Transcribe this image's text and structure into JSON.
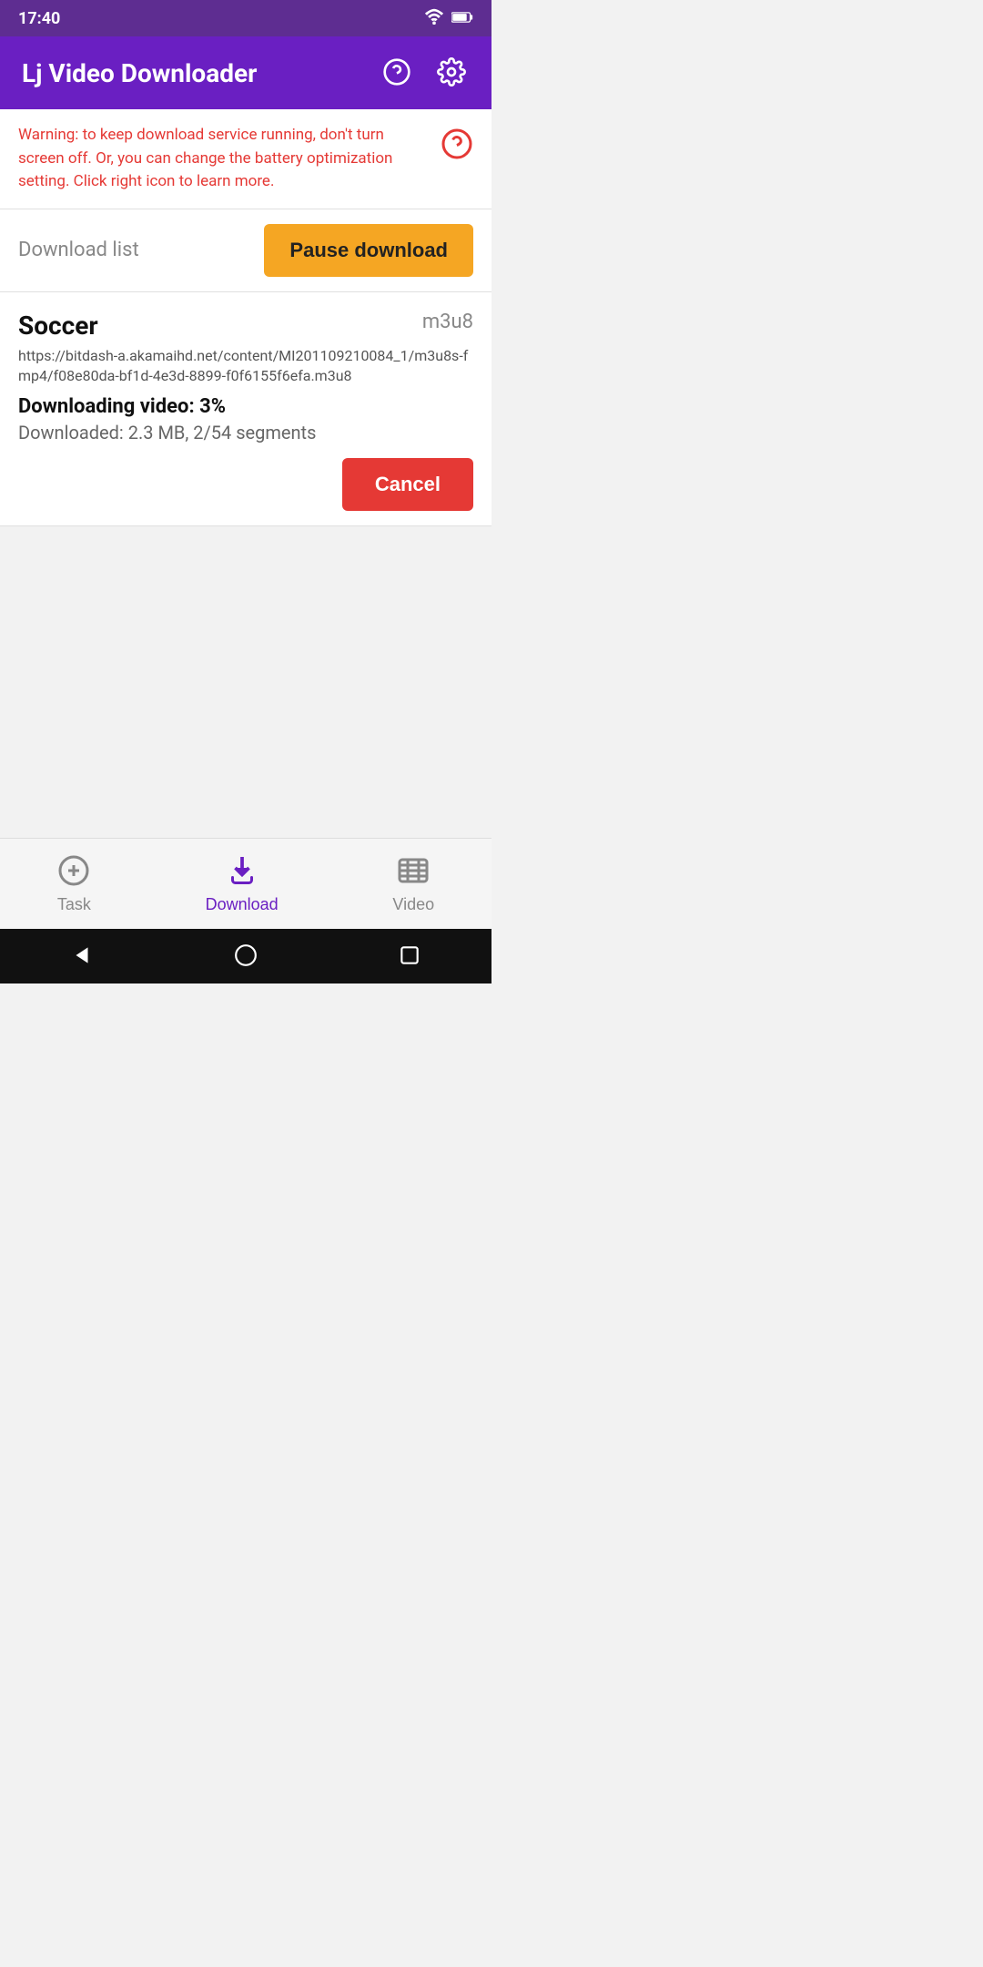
{
  "statusBar": {
    "time": "17:40"
  },
  "appBar": {
    "title": "Lj Video Downloader",
    "helpIcon": "help-circle-icon",
    "settingsIcon": "settings-icon"
  },
  "warning": {
    "text": "Warning: to keep download service running, don't turn screen off. Or, you can change the battery optimization setting. Click right icon to learn more.",
    "icon": "question-circle-icon"
  },
  "downloadSection": {
    "sectionTitle": "Download list",
    "pauseButtonLabel": "Pause download"
  },
  "downloadItem": {
    "name": "Soccer",
    "type": "m3u8",
    "url": "https://bitdash-a.akamaihd.net/content/MI201109210084_1/m3u8s-fmp4/f08e80da-bf1d-4e3d-8899-f0f6155f6efa.m3u8",
    "progressLabel": "Downloading video: 3%",
    "downloadedLabel": "Downloaded: 2.3 MB, 2/54 segments",
    "cancelButtonLabel": "Cancel"
  },
  "bottomNav": {
    "items": [
      {
        "id": "task",
        "label": "Task",
        "active": false
      },
      {
        "id": "download",
        "label": "Download",
        "active": true
      },
      {
        "id": "video",
        "label": "Video",
        "active": false
      }
    ]
  },
  "sysNav": {
    "backIcon": "back-icon",
    "homeIcon": "home-icon",
    "recentIcon": "recent-icon"
  }
}
